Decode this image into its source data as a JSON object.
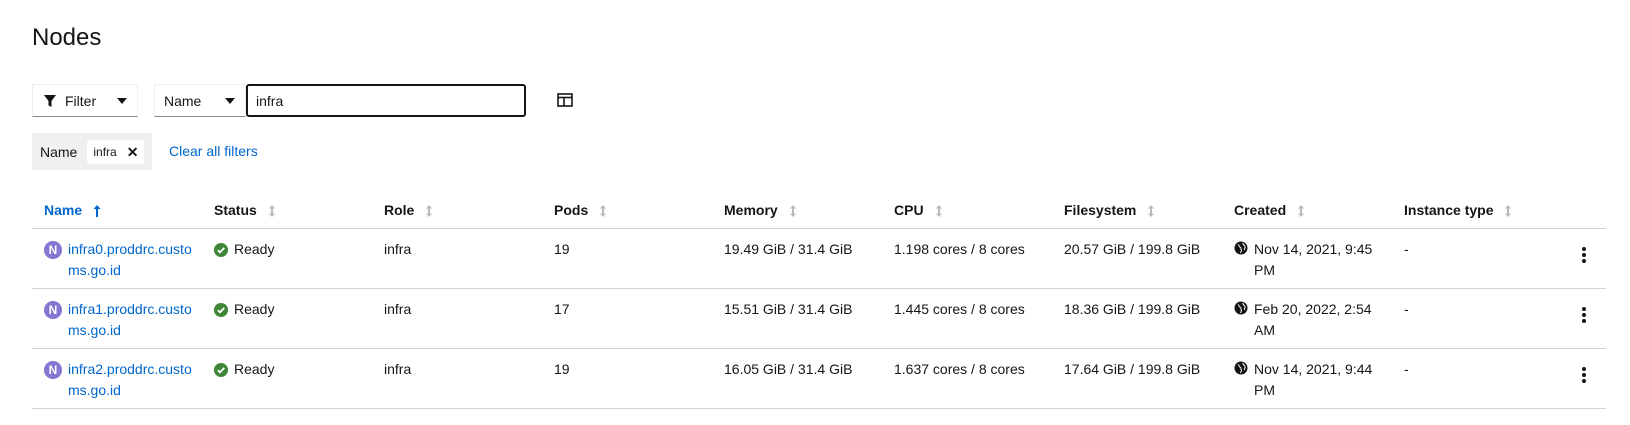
{
  "page": {
    "title": "Nodes"
  },
  "toolbar": {
    "filter_label": "Filter",
    "attribute_label": "Name",
    "search_value": "infra",
    "columns_icon": "columns-icon"
  },
  "chips": {
    "category": "Name",
    "value": "infra",
    "clear_all": "Clear all filters"
  },
  "table": {
    "columns": [
      "Name",
      "Status",
      "Role",
      "Pods",
      "Memory",
      "CPU",
      "Filesystem",
      "Created",
      "Instance type"
    ],
    "sorted_column": "Name",
    "rows": [
      {
        "badge": "N",
        "name": "infra0.proddrc.customs.go.id",
        "status": "Ready",
        "role": "infra",
        "pods": "19",
        "memory": "19.49 GiB / 31.4 GiB",
        "cpu": "1.198 cores / 8 cores",
        "filesystem": "20.57 GiB / 199.8 GiB",
        "created": "Nov 14, 2021, 9:45 PM",
        "instance_type": "-"
      },
      {
        "badge": "N",
        "name": "infra1.proddrc.customs.go.id",
        "status": "Ready",
        "role": "infra",
        "pods": "17",
        "memory": "15.51 GiB / 31.4 GiB",
        "cpu": "1.445 cores / 8 cores",
        "filesystem": "18.36 GiB / 199.8 GiB",
        "created": "Feb 20, 2022, 2:54 AM",
        "instance_type": "-"
      },
      {
        "badge": "N",
        "name": "infra2.proddrc.customs.go.id",
        "status": "Ready",
        "role": "infra",
        "pods": "19",
        "memory": "16.05 GiB / 31.4 GiB",
        "cpu": "1.637 cores / 8 cores",
        "filesystem": "17.64 GiB / 199.8 GiB",
        "created": "Nov 14, 2021, 9:44 PM",
        "instance_type": "-"
      }
    ]
  },
  "colors": {
    "link": "#0066cc",
    "ready": "#3e8635",
    "node_badge": "#8476d1",
    "text": "#151515"
  }
}
